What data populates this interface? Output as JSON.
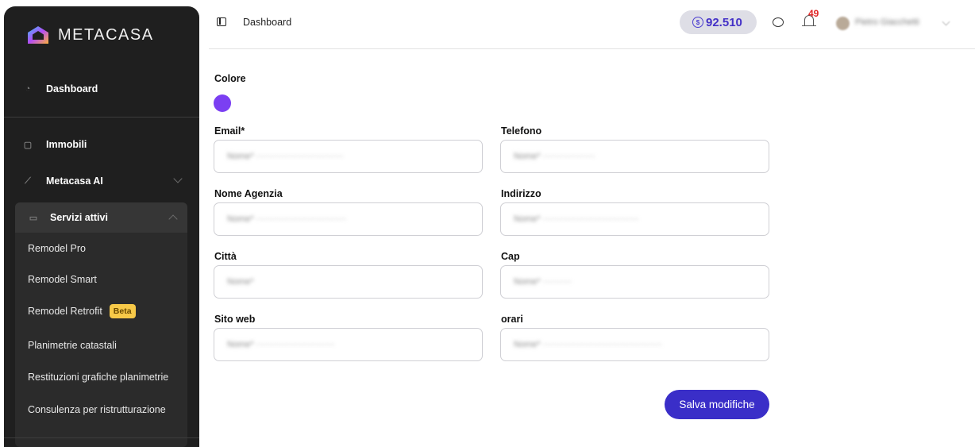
{
  "sidebar": {
    "brand": "METACASA",
    "dashboard": "Dashboard",
    "immobili": "Immobili",
    "ai": "Metacasa AI",
    "services_header": "Servizi attivi",
    "services": [
      "Remodel Pro",
      "Remodel Smart",
      "Remodel Retrofit",
      "Planimetrie catastali",
      "Restituzioni grafiche planimetrie",
      "Consulenza per ristrutturazione"
    ],
    "beta_badge": "Beta"
  },
  "topbar": {
    "breadcrumb": "Dashboard",
    "credits": "92.510",
    "notifications": "49",
    "user_name": "Pietro Giacchetti"
  },
  "form": {
    "color_label": "Colore",
    "color_value": "#7b3ff2",
    "email_label": "Email*",
    "email_value": "Nome* ······························",
    "telefono_label": "Telefono",
    "telefono_value": "Nome* ··················",
    "agenzia_label": "Nome Agenzia",
    "agenzia_value": "Nome* ·······························",
    "indirizzo_label": "Indirizzo",
    "indirizzo_value": "Nome* ·································",
    "citta_label": "Città",
    "citta_value": "Nome*",
    "cap_label": "Cap",
    "cap_value": "Nome* ··········",
    "sito_label": "Sito web",
    "sito_value": "Nome* ···························",
    "orari_label": "orari",
    "orari_value": "Nome* ·········································",
    "save_label": "Salva modifiche"
  },
  "colors": {
    "accent": "#3a2ec8",
    "sidebar_bg": "#1f1f1f",
    "beta_bg": "#f7c948",
    "badge": "#e02424"
  }
}
